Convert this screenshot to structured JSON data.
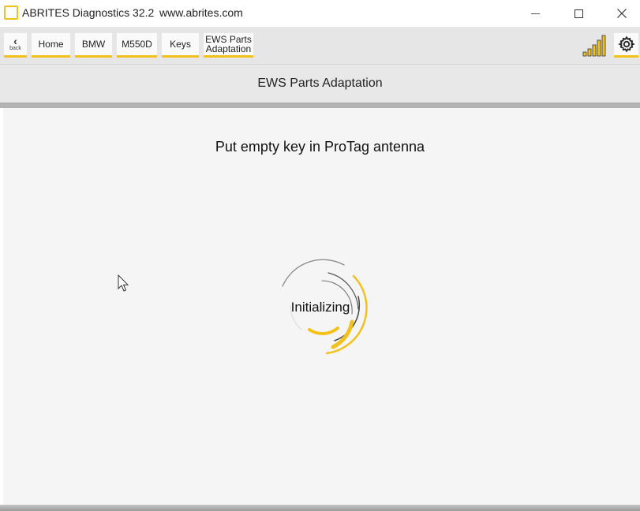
{
  "window": {
    "title": "ABRITES Diagnostics 32.2",
    "url": "www.abrites.com"
  },
  "toolbar": {
    "back_label": "back",
    "breadcrumbs": [
      "Home",
      "BMW",
      "M550D",
      "Keys"
    ],
    "current": [
      "EWS Parts",
      "Adaptation"
    ]
  },
  "section": {
    "title": "EWS Parts Adaptation"
  },
  "main": {
    "instruction": "Put empty key in ProTag antenna",
    "status": "Initializing"
  },
  "colors": {
    "accent": "#f2c21b",
    "panel": "#f5f5f5",
    "header": "#e8e8e8"
  },
  "icons": {
    "logo": "abrites-logo-icon",
    "signal": "signal-strength-icon",
    "settings": "gear-icon",
    "back": "chevron-left-icon"
  }
}
